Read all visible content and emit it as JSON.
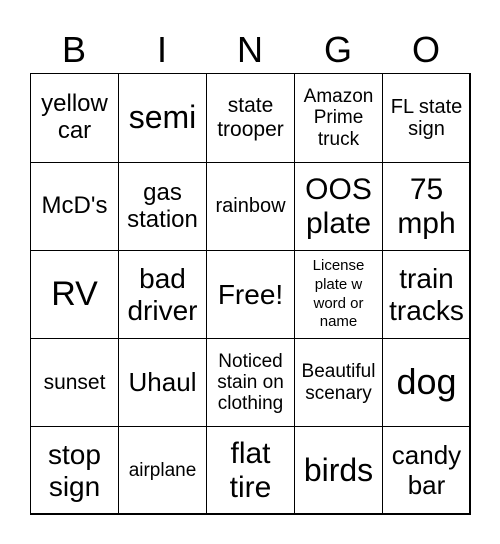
{
  "header": {
    "letters": [
      "B",
      "I",
      "N",
      "G",
      "O"
    ]
  },
  "cells": [
    "yellow car",
    "semi",
    "state trooper",
    "Amazon Prime truck",
    "FL state sign",
    "McD's",
    "gas station",
    "rainbow",
    "OOS plate",
    "75 mph",
    "RV",
    "bad driver",
    "Free!",
    "License plate w word or name",
    "train tracks",
    "sunset",
    "Uhaul",
    "Noticed stain on clothing",
    "Beautiful scenary",
    "dog",
    "stop sign",
    "airplane",
    "flat tire",
    "birds",
    "candy bar"
  ]
}
